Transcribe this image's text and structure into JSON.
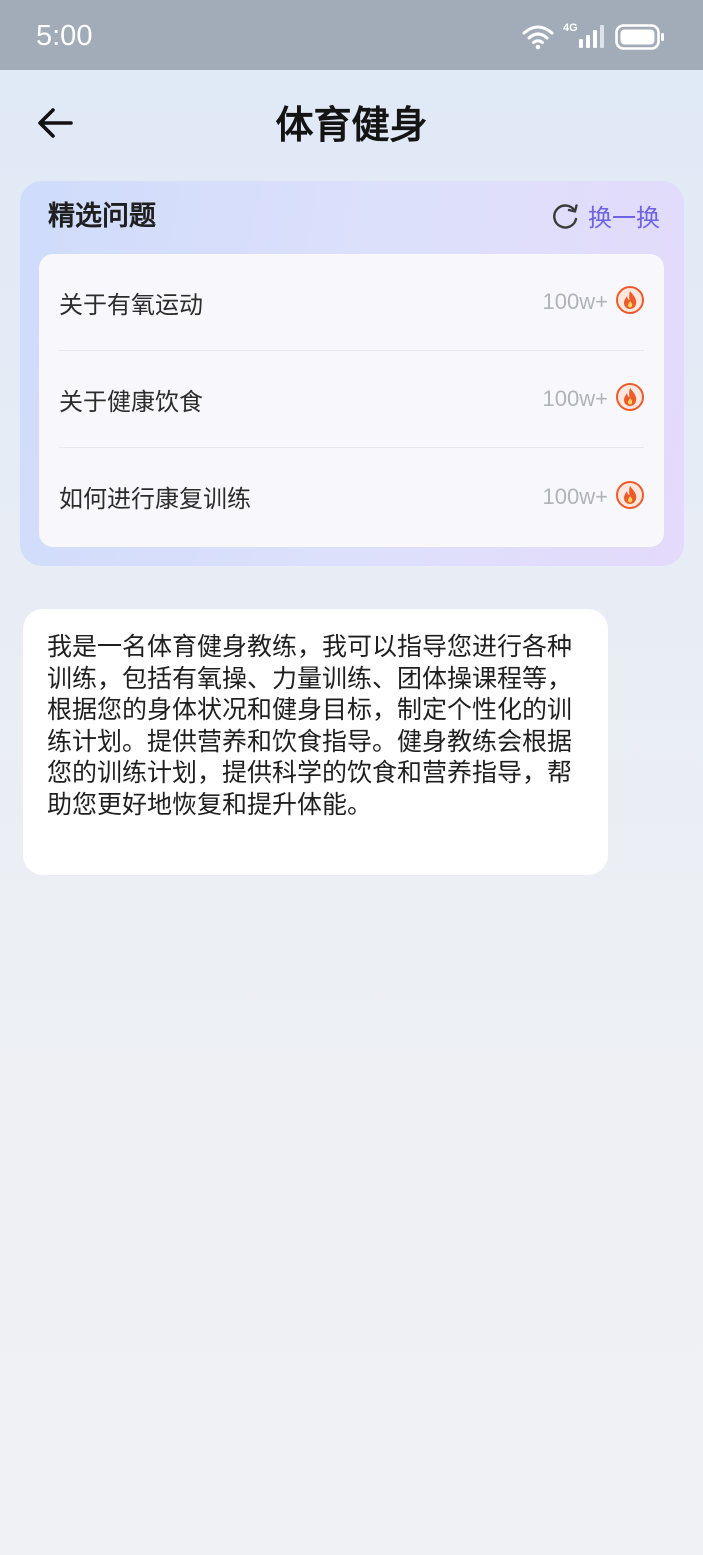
{
  "status_bar": {
    "time": "5:00",
    "network": "4G",
    "icons": [
      "wifi-icon",
      "signal-icon",
      "battery-icon"
    ]
  },
  "header": {
    "back_icon": "arrow-left-icon",
    "title": "体育健身"
  },
  "featured": {
    "title": "精选问题",
    "refresh_icon": "refresh-icon",
    "refresh_label": "换一换",
    "items": [
      {
        "label": "关于有氧运动",
        "count": "100w+",
        "icon": "fire-icon"
      },
      {
        "label": "关于健康饮食",
        "count": "100w+",
        "icon": "fire-icon"
      },
      {
        "label": "如何进行康复训练",
        "count": "100w+",
        "icon": "fire-icon"
      }
    ]
  },
  "intro": {
    "text": "我是一名体育健身教练，我可以指导您进行各种训练，包括有氧操、力量训练、团体操课程等，根据您的身体状况和健身目标，制定个性化的训练计划。提供营养和饮食指导。健身教练会根据您的训练计划，提供科学的饮食和营养指导，帮助您更好地恢复和提升体能。"
  },
  "colors": {
    "accent": "#6d63e0",
    "fire": "#ee5a2a",
    "status_bar": "#a2acb8"
  }
}
